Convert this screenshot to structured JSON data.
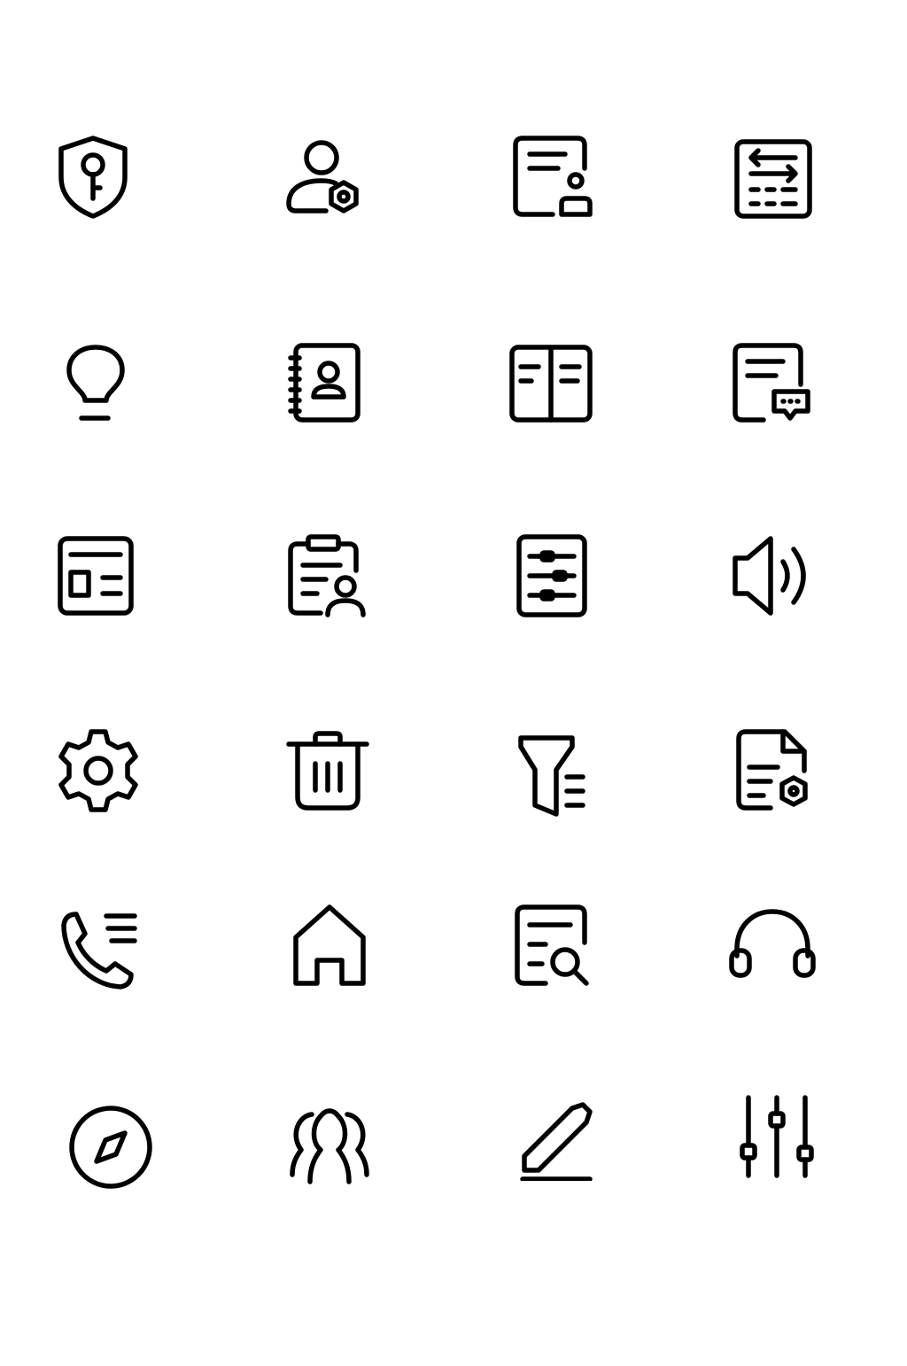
{
  "style": {
    "stroke_color": "#000000",
    "background": "#ffffff"
  },
  "icons": [
    "shield-key-icon",
    "user-settings-icon",
    "document-user-icon",
    "table-exchange-icon",
    "lightbulb-icon",
    "contact-book-icon",
    "open-book-icon",
    "document-chat-icon",
    "news-layout-icon",
    "clipboard-user-icon",
    "document-sliders-icon",
    "speaker-icon",
    "gear-icon",
    "trash-icon",
    "filter-list-icon",
    "document-settings-icon",
    "phone-list-icon",
    "home-icon",
    "document-search-icon",
    "headphones-icon",
    "compass-icon",
    "user-group-icon",
    "edit-pencil-icon",
    "sliders-icon"
  ]
}
